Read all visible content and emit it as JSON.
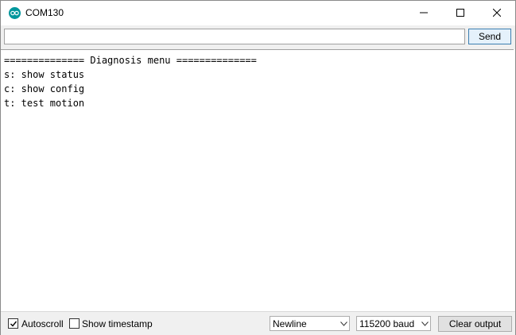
{
  "window": {
    "title": "COM130",
    "icon": "arduino-icon"
  },
  "controls": {
    "minimize_icon": "minimize-icon",
    "maximize_icon": "maximize-icon",
    "close_icon": "close-icon"
  },
  "input": {
    "value": "",
    "placeholder": "",
    "send_label": "Send"
  },
  "output": {
    "lines": [
      "============== Diagnosis menu ==============",
      "s: show status",
      "c: show config",
      "t: test motion"
    ]
  },
  "footer": {
    "autoscroll": {
      "label": "Autoscroll",
      "checked": true
    },
    "timestamp": {
      "label": "Show timestamp",
      "checked": false
    },
    "line_ending": {
      "selected": "Newline"
    },
    "baud_rate": {
      "selected": "115200 baud"
    },
    "clear_label": "Clear output"
  },
  "colors": {
    "accent": "#00979d",
    "send_border": "#3c7fb1",
    "send_bg": "#e5f1fb",
    "bar_bg": "#f0f0f0"
  }
}
